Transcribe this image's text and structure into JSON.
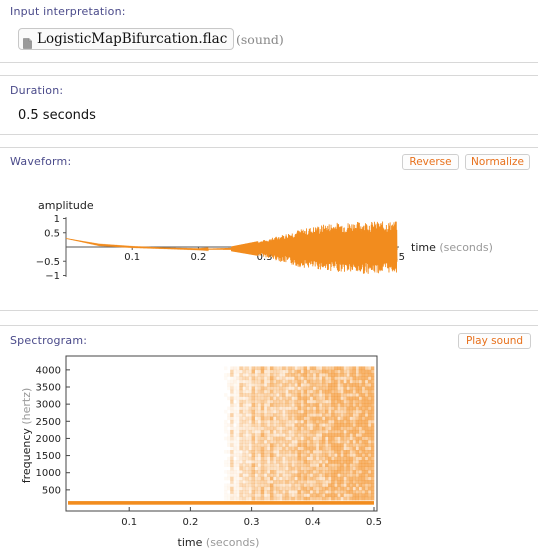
{
  "input_pod": {
    "title": "Input interpretation:",
    "file_name": "LogisticMapBifurcation.flac",
    "file_type": "(sound)"
  },
  "duration_pod": {
    "title": "Duration:",
    "value": "0.5 seconds"
  },
  "waveform_pod": {
    "title": "Waveform:",
    "reverse_label": "Reverse",
    "normalize_label": "Normalize"
  },
  "spectrogram_pod": {
    "title": "Spectrogram:",
    "play_label": "Play sound"
  },
  "colors": {
    "accent": "#f28c1e",
    "link": "#e8711c",
    "title": "#4a4a8a"
  },
  "chart_data": [
    {
      "type": "line",
      "title": "",
      "xlabel": "time (seconds)",
      "ylabel": "amplitude",
      "xlim": [
        0,
        0.5
      ],
      "ylim": [
        -1,
        1
      ],
      "x_ticks": [
        "0.1",
        "0.2",
        "0.3",
        "0.4",
        "0.5"
      ],
      "y_ticks": [
        "1",
        "0.5",
        "-0.5",
        "-1"
      ],
      "series": [
        {
          "x": [
            0,
            0.05,
            0.1,
            0.15,
            0.2,
            0.25,
            0.3,
            0.35,
            0.4,
            0.45,
            0.5
          ],
          "envelope_upper": [
            0.3,
            0.1,
            0.02,
            -0.03,
            -0.06,
            0.02,
            0.25,
            0.6,
            0.85,
            0.9,
            0.9
          ],
          "envelope_lower": [
            0.3,
            0.05,
            -0.02,
            -0.06,
            -0.1,
            -0.15,
            -0.35,
            -0.7,
            -0.85,
            -0.95,
            -0.9
          ]
        }
      ]
    },
    {
      "type": "heatmap",
      "title": "",
      "xlabel": "time (seconds)",
      "ylabel": "frequency (hertz)",
      "xlim": [
        0,
        0.5
      ],
      "ylim": [
        0,
        4200
      ],
      "x_ticks": [
        "0.1",
        "0.2",
        "0.3",
        "0.4",
        "0.5"
      ],
      "y_ticks": [
        "500",
        "1000",
        "1500",
        "2000",
        "2500",
        "3000",
        "3500",
        "4000"
      ],
      "fundamental_hz": 120,
      "noise_onset_seconds": 0.28
    }
  ]
}
